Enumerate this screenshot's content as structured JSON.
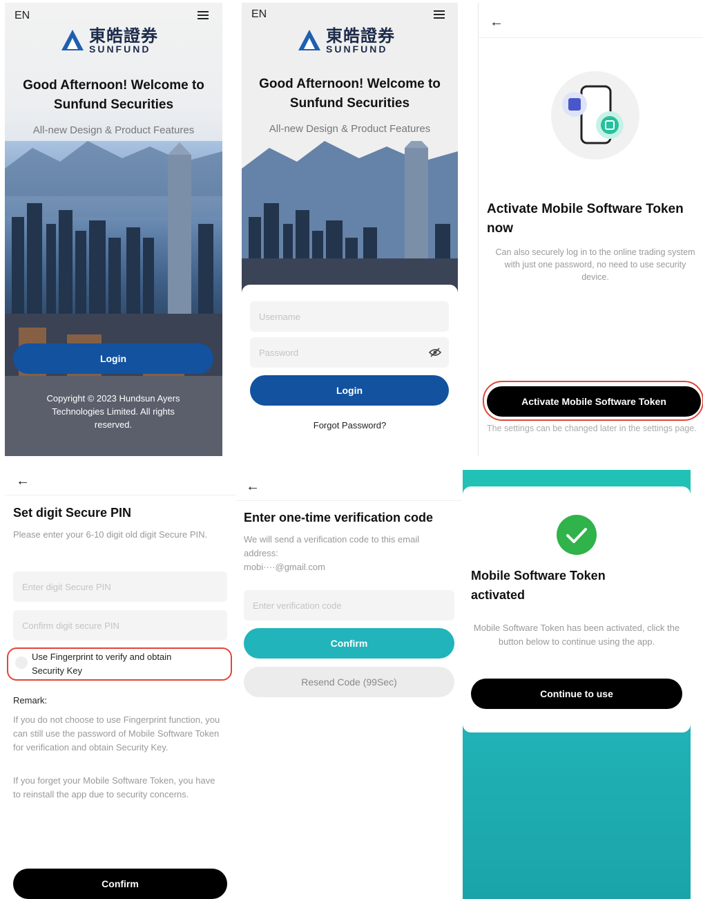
{
  "screens": {
    "s1": {
      "lang": "EN",
      "logo_cn": "東皓證券",
      "logo_en": "SUNFUND",
      "greeting_line1": "Good Afternoon!  Welcome to",
      "greeting_line2": "Sunfund Securities",
      "tagline": "All-new Design & Product Features",
      "login_label": "Login",
      "copyright": "Copyright © 2023 Hundsun Ayers Technologies Limited. All rights reserved."
    },
    "s2": {
      "lang": "EN",
      "logo_cn": "東皓證券",
      "logo_en": "SUNFUND",
      "greeting_line1": "Good Afternoon!  Welcome to",
      "greeting_line2": "Sunfund Securities",
      "tagline": "All-new Design & Product Features",
      "username_placeholder": "Username",
      "password_placeholder": "Password",
      "login_label": "Login",
      "forgot_label": "Forgot Password?"
    },
    "s3": {
      "title": "Activate Mobile Software Token now",
      "description": "Can also securely log in to the online trading system with just one password, no need to use security device.",
      "activate_label": "Activate Mobile Software Token",
      "note": "The settings can be changed later in the settings page."
    },
    "s4": {
      "title": "Set digit Secure PIN",
      "description": "Please enter your 6-10 digit old digit Secure PIN.",
      "pin_placeholder": "Enter digit Secure PIN",
      "confirm_pin_placeholder": "Confirm digit secure PIN",
      "fingerprint_label": "Use  Fingerprint  to verify and obtain Security Key",
      "remark_title": "Remark:",
      "remark_1": "If you do not choose to use  Fingerprint function, you can still use the password of Mobile Software Token for verification and obtain Security Key.",
      "remark_2": "If you forget your Mobile Software Token, you have to reinstall the app due to security concerns.",
      "confirm_label": "Confirm"
    },
    "s5": {
      "title": "Enter one-time verification code",
      "description": "We will send a verification code to this email address:",
      "email": "mobi····@gmail.com",
      "code_placeholder": "Enter verification code",
      "confirm_label": "Confirm",
      "resend_label": "Resend Code (99Sec)"
    },
    "s6": {
      "title": "Mobile Software Token activated",
      "description": "Mobile Software Token has been activated, click the button below to continue using the app.",
      "continue_label": "Continue to use"
    }
  },
  "colors": {
    "brand_blue": "#12529f",
    "teal": "#21b4bb",
    "success_green": "#2fb34a",
    "highlight_red": "#e0463a"
  },
  "icons": [
    "menu-icon",
    "back-arrow-icon",
    "eye-off-icon",
    "phone-token-icon",
    "check-icon",
    "radio-icon"
  ]
}
